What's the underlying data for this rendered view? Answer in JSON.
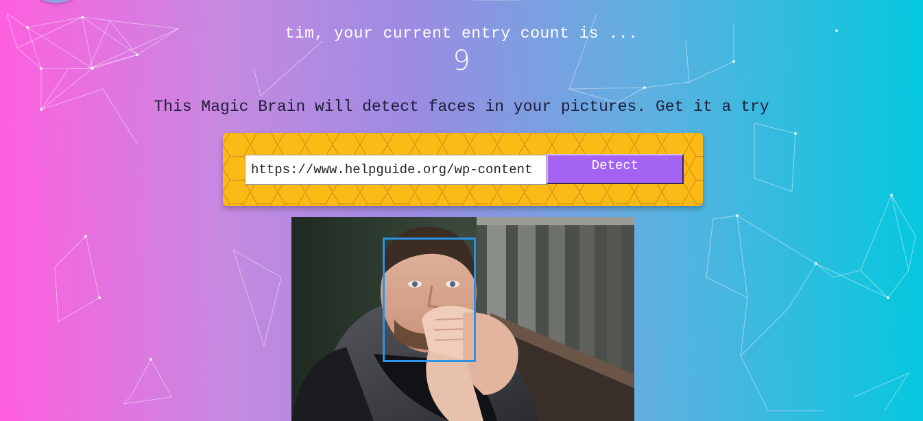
{
  "rank": {
    "message": "tim, your current entry count is ...",
    "count": "9"
  },
  "tagline": "This Magic Brain will detect faces in your pictures. Get it a try",
  "image_form": {
    "url_value": "https://www.helpguide.org/wp-content",
    "button_label": "Detect"
  },
  "result": {
    "faces_detected": 1
  },
  "colors": {
    "form_background": "#fbba15",
    "button": "#a463f2",
    "face_box": "#2a93e8"
  }
}
